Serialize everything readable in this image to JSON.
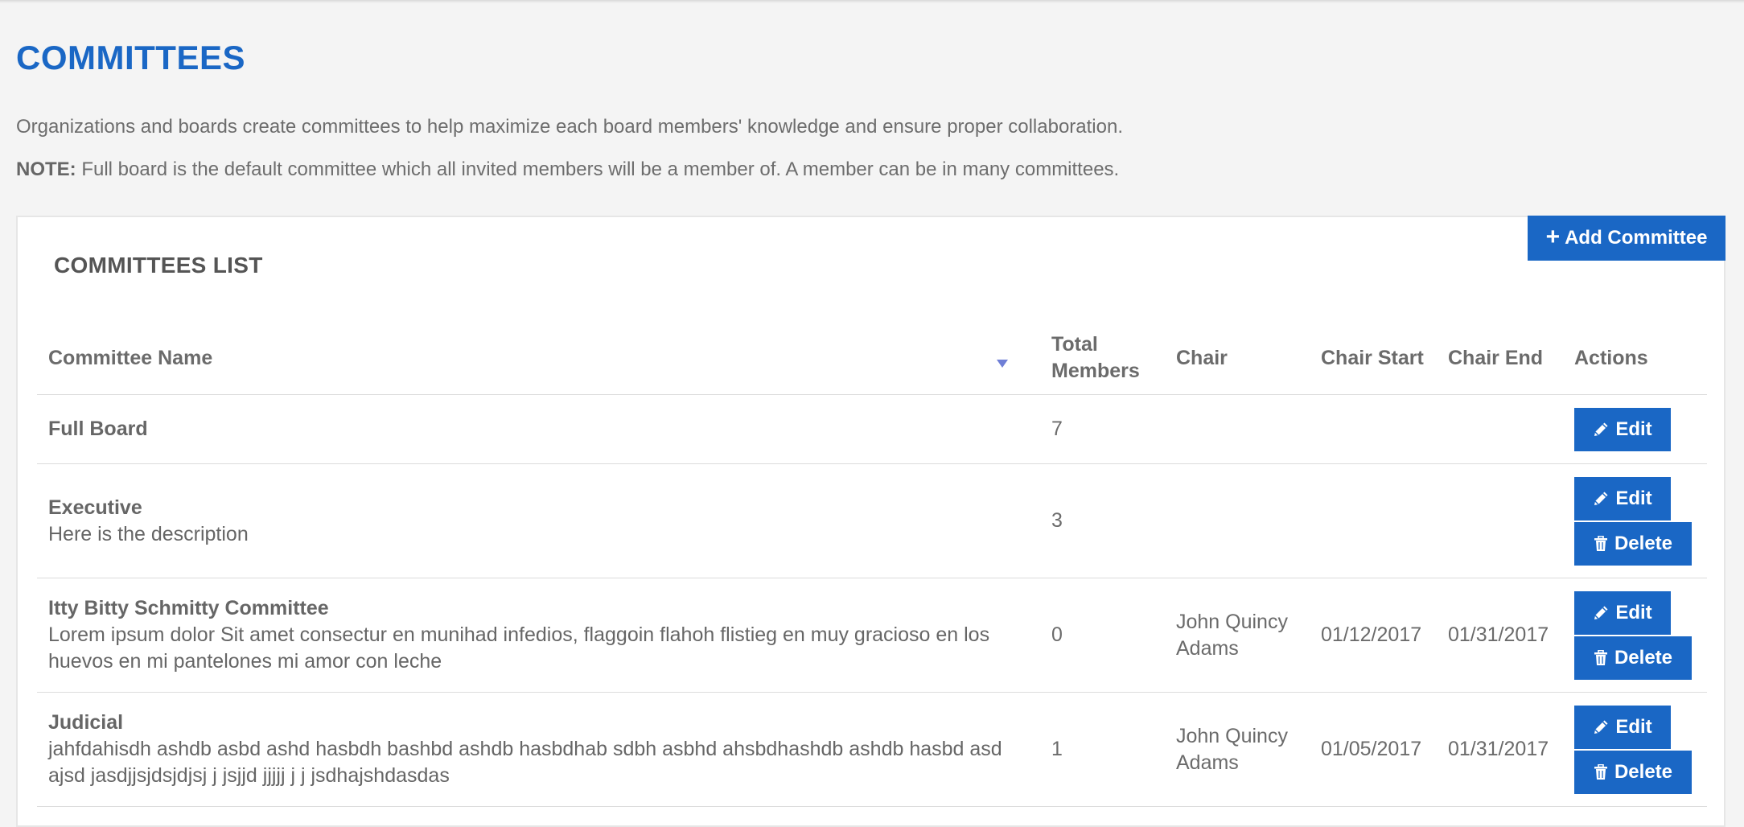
{
  "page": {
    "title": "COMMITTEES",
    "intro": "Organizations and boards create committees to help maximize each board members' knowledge and ensure proper collaboration.",
    "note_label": "NOTE:",
    "note_text": " Full board is the default committee which all invited members will be a member of. A member can be in many committees."
  },
  "panel": {
    "title": "COMMITTEES LIST",
    "add_button": "Add Committee",
    "add_icon": "plus-icon"
  },
  "table": {
    "columns": {
      "name": "Committee Name",
      "total_members_line1": "Total",
      "total_members_line2": "Members",
      "chair": "Chair",
      "chair_start": "Chair Start",
      "chair_end": "Chair End",
      "actions": "Actions"
    },
    "sort_icon": "sort-down-icon",
    "rows": [
      {
        "name": "Full Board",
        "description": "",
        "total_members": "7",
        "chair": "",
        "chair_start": "",
        "chair_end": "",
        "edit_label": "Edit"
      },
      {
        "name": "Executive",
        "description": "Here is the description",
        "total_members": "3",
        "chair": "",
        "chair_start": "",
        "chair_end": "",
        "edit_label": "Edit",
        "delete_label": "Delete"
      },
      {
        "name": "Itty Bitty Schmitty Committee",
        "description": "Lorem ipsum dolor Sit amet consectur en munihad infedios, flaggoin flahoh flistieg en muy gracioso en los huevos en mi pantelones mi amor con leche",
        "total_members": "0",
        "chair": "John Quincy Adams",
        "chair_start": "01/12/2017",
        "chair_end": "01/31/2017",
        "edit_label": "Edit",
        "delete_label": "Delete"
      },
      {
        "name": "Judicial",
        "description": "jahfdahisdh ashdb asbd ashd hasbdh bashbd ashdb hasbdhab sdbh asbhd ahsbdhashdb ashdb hasbd asd ajsd jasdjjsjdsjdjsj j jsjjd jjjjj j j jsdhajshdasdas",
        "total_members": "1",
        "chair": "John Quincy Adams",
        "chair_start": "01/05/2017",
        "chair_end": "01/31/2017",
        "edit_label": "Edit",
        "delete_label": "Delete"
      }
    ]
  },
  "colors": {
    "accent": "#1a67c5",
    "background": "#f4f4f4",
    "sort_arrow": "#6f7fd6"
  }
}
